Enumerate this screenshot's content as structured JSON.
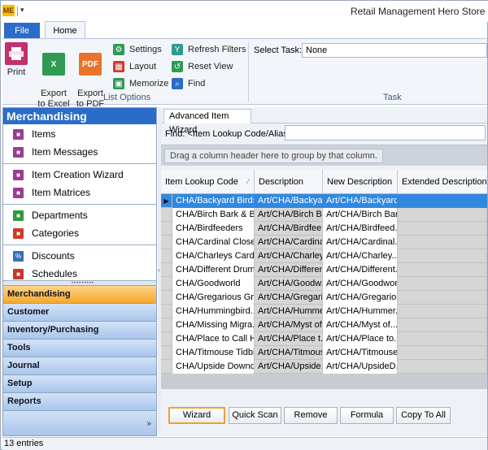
{
  "window": {
    "title": "Retail Management Hero Store Mana"
  },
  "app_icon": {
    "glyph": "ME"
  },
  "ribbon": {
    "tabs": [
      "File",
      "Home"
    ],
    "buttons": {
      "print": "Print",
      "export_excel": "Export\nto Excel",
      "export_pdf": "Export\nto PDF",
      "settings": "Settings",
      "layout": "Layout",
      "memorize": "Memorize",
      "refresh_filters": "Refresh Filters",
      "reset_view": "Reset View",
      "find": "Find"
    },
    "groups": {
      "list_options": "List Options",
      "task": "Task"
    },
    "task": {
      "label": "Select Task:",
      "value": "None"
    }
  },
  "nav": {
    "header": "Merchandising",
    "items": [
      {
        "label": "Items",
        "icon": "items-icon",
        "color": "#9b3d91"
      },
      {
        "label": "Item Messages",
        "icon": "item-messages-icon",
        "color": "#9b3d91"
      },
      {
        "label": "Item Creation Wizard",
        "icon": "item-wizard-icon",
        "color": "#9b3d91"
      },
      {
        "label": "Item Matrices",
        "icon": "item-matrices-icon",
        "color": "#9b3d91"
      },
      {
        "label": "Departments",
        "icon": "departments-icon",
        "color": "#2e9a3c"
      },
      {
        "label": "Categories",
        "icon": "categories-icon",
        "color": "#d03a2a"
      },
      {
        "label": "Discounts",
        "icon": "discounts-icon",
        "color": "#3a6fb8"
      },
      {
        "label": "Schedules",
        "icon": "schedules-icon",
        "color": "#c0392b"
      }
    ],
    "sections": [
      "Merchandising",
      "Customer",
      "Inventory/Purchasing",
      "Tools",
      "Journal",
      "Setup",
      "Reports"
    ]
  },
  "main": {
    "doc_tab": "Advanced Item Wizard",
    "find_label": "Find: <Item Lookup Code/Alias>",
    "find_value": "",
    "group_hint": "Drag a column header here to group by that column.",
    "columns": [
      "Item Lookup Code",
      "Description",
      "New Description",
      "Extended Description"
    ],
    "rows": [
      [
        "CHA/Backyard Birds",
        "Art/CHA/Backya...",
        "Art/CHA/Backyard...",
        ""
      ],
      [
        "CHA/Birch Bark & B...",
        "Art/CHA/Birch B...",
        "Art/CHA/Birch Bar...",
        ""
      ],
      [
        "CHA/Birdfeeders",
        "Art/CHA/Birdfee...",
        "Art/CHA/Birdfeed...",
        ""
      ],
      [
        "CHA/Cardinal Close...",
        "Art/CHA/Cardina...",
        "Art/CHA/Cardinal...",
        ""
      ],
      [
        "CHA/Charleys Cardi...",
        "Art/CHA/Charley...",
        "Art/CHA/Charley...",
        ""
      ],
      [
        "CHA/Different Drum...",
        "Art/CHA/Differen...",
        "Art/CHA/Different...",
        ""
      ],
      [
        "CHA/Goodworld",
        "Art/CHA/Goodw...",
        "Art/CHA/Goodwor...",
        ""
      ],
      [
        "CHA/Gregarious Gr...",
        "Art/CHA/Gregari...",
        "Art/CHA/Gregario...",
        ""
      ],
      [
        "CHA/Hummingbird...",
        "Art/CHA/Humme...",
        "Art/CHA/Hummer...",
        ""
      ],
      [
        "CHA/Missing Migra...",
        "Art/CHA/Myst of...",
        "Art/CHA/Myst of...",
        ""
      ],
      [
        "CHA/Place to Call H...",
        "Art/CHA/Place t...",
        "Art/CHA/Place to...",
        ""
      ],
      [
        "CHA/Titmouse Tidbit",
        "Art/CHA/Titmous...",
        "Art/CHA/Titmouse...",
        ""
      ],
      [
        "CHA/Upside Downd...",
        "Art/CHA/Upside...",
        "Art/CHA/UpsideD...",
        ""
      ]
    ],
    "selected_row": 0,
    "actions": [
      "Wizard",
      "Quick Scan",
      "Remove",
      "Formula",
      "Copy To All"
    ]
  },
  "status": {
    "text": "13 entries"
  },
  "colors": {
    "accent": "#2b6cc8",
    "selection": "#3088e0",
    "active_section": "#f7a827"
  }
}
